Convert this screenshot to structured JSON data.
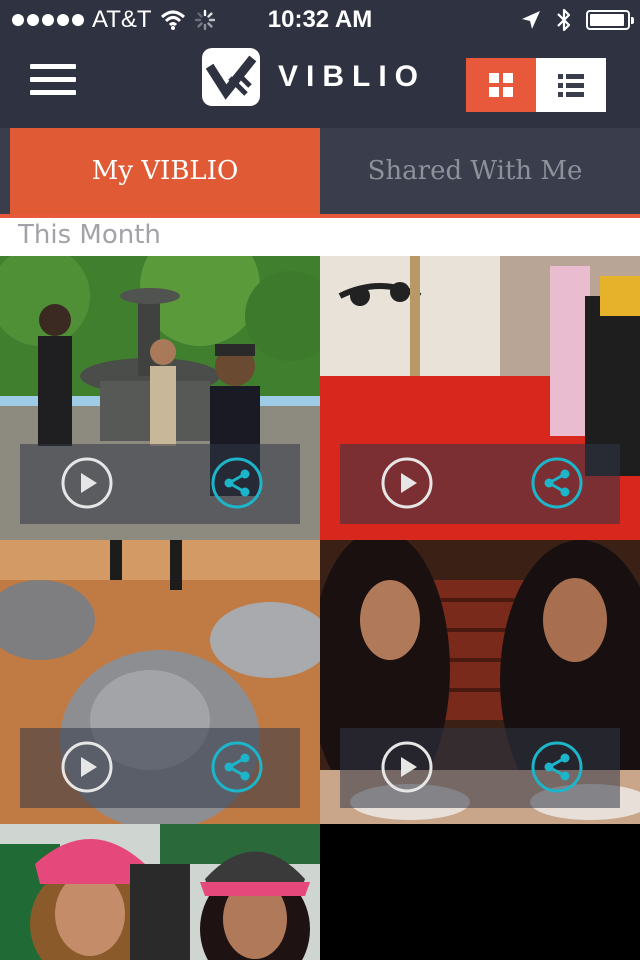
{
  "status_bar": {
    "carrier": "AT&T",
    "time": "10:32 AM",
    "battery_level": 0.95
  },
  "header": {
    "logo_text": "VIBLIO",
    "menu_icon": "hamburger-menu-icon",
    "view_modes": [
      "grid",
      "list"
    ],
    "active_view": "grid"
  },
  "tabs": [
    {
      "label": "My VIBLIO",
      "active": true
    },
    {
      "label": "Shared With Me",
      "active": false
    }
  ],
  "section": {
    "title": "This Month"
  },
  "colors": {
    "accent": "#e8583a",
    "header_bg": "#2f3241",
    "share_icon": "#1cb5c9"
  },
  "videos": [
    {
      "scene": "park-fountain",
      "play_icon": "play-icon",
      "share_icon": "share-icon"
    },
    {
      "scene": "red-floor",
      "play_icon": "play-icon",
      "share_icon": "share-icon"
    },
    {
      "scene": "silver-statues",
      "play_icon": "play-icon",
      "share_icon": "share-icon"
    },
    {
      "scene": "restaurant-eating",
      "play_icon": "play-icon",
      "share_icon": "share-icon"
    },
    {
      "scene": "street-portrait"
    }
  ]
}
